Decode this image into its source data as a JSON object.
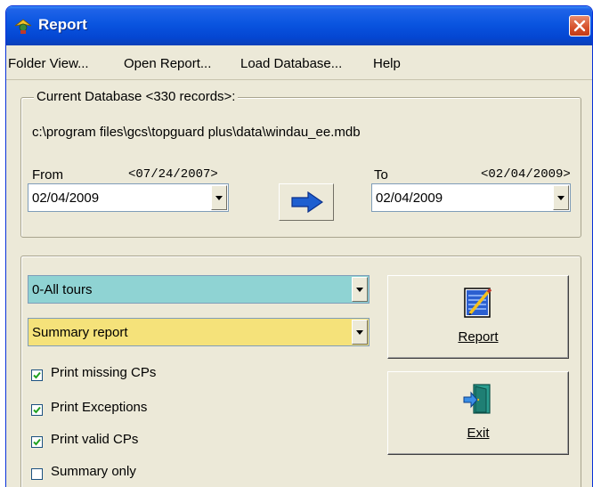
{
  "window": {
    "title": "Report"
  },
  "menu": {
    "items": [
      "Folder View...",
      "Open Report...",
      "Load Database...",
      "Help"
    ]
  },
  "database": {
    "group_title": "Current Database <330 records>:",
    "path": "c:\\program files\\gcs\\topguard plus\\data\\windau_ee.mdb"
  },
  "date_range": {
    "from_label": "From",
    "from_hint": "<07/24/2007>",
    "from_value": "02/04/2009",
    "to_label": "To",
    "to_hint": "<02/04/2009>",
    "to_value": "02/04/2009"
  },
  "filters": {
    "tour_value": "0-All tours",
    "report_type_value": "Summary report"
  },
  "options": [
    {
      "label": "Print missing CPs",
      "checked": true
    },
    {
      "label": "Print Exceptions",
      "checked": true
    },
    {
      "label": "Print valid CPs",
      "checked": true
    },
    {
      "label": "Summary only",
      "checked": false
    }
  ],
  "buttons": {
    "report_label": "Report",
    "exit_label": "Exit"
  },
  "colors": {
    "tour_bg": "#8fd3d3",
    "report_type_bg": "#f5e27a",
    "titlebar": "#0a55e0"
  }
}
